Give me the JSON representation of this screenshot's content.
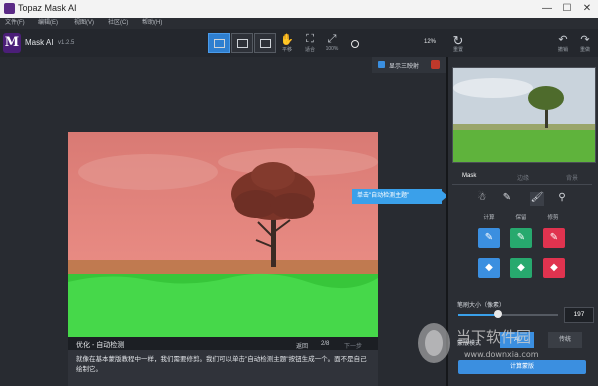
{
  "window": {
    "title": "Topaz Mask AI",
    "minimize": "—",
    "maximize": "☐",
    "close": "✕"
  },
  "menu": [
    "文件(F)",
    "编辑(E)",
    "视图(V)",
    "社区(C)",
    "帮助(H)"
  ],
  "app": {
    "logo_letter": "M",
    "name": "Mask AI",
    "version": "v1.2.5"
  },
  "toolbar": {
    "pan_label": "平移",
    "fit_label": "适合",
    "zoom100_label": "100%",
    "zoom_value": "12%",
    "reset_label": "重置",
    "undo_label": "撤销",
    "redo_label": "重做"
  },
  "canvas": {
    "show_triple_label": "显示三映射"
  },
  "tooltip": {
    "text": "单击\"自动检测主题\""
  },
  "caption": {
    "title": "优化 - 自动检测",
    "back": "返回",
    "page": "2/8",
    "next": "下一步",
    "text": "就像在基本蒙版教程中一样，我们需要修剪。我们可以单击\"自动检测主题\"按钮生成一个。面不是自己绘制它。"
  },
  "panel": {
    "tabs": [
      "Mask",
      "边缘",
      "背景"
    ],
    "sections": [
      "计算",
      "保留",
      "修剪"
    ],
    "brush_size_label": "笔刷大小（像素）",
    "brush_size_value": "197",
    "brush_size_fraction": 0.4,
    "mode_label": "蒙版模式",
    "mode_ai": "AI",
    "mode_traditional": "传统",
    "compute_button": "计算蒙版"
  },
  "colors": {
    "accent": "#3b8fe0",
    "keep": "#27a96e",
    "cut": "#e0334f",
    "mask_overlay": "#ff6b6b"
  },
  "watermark": {
    "text": "当下软件园",
    "url": "www.downxia.com"
  }
}
